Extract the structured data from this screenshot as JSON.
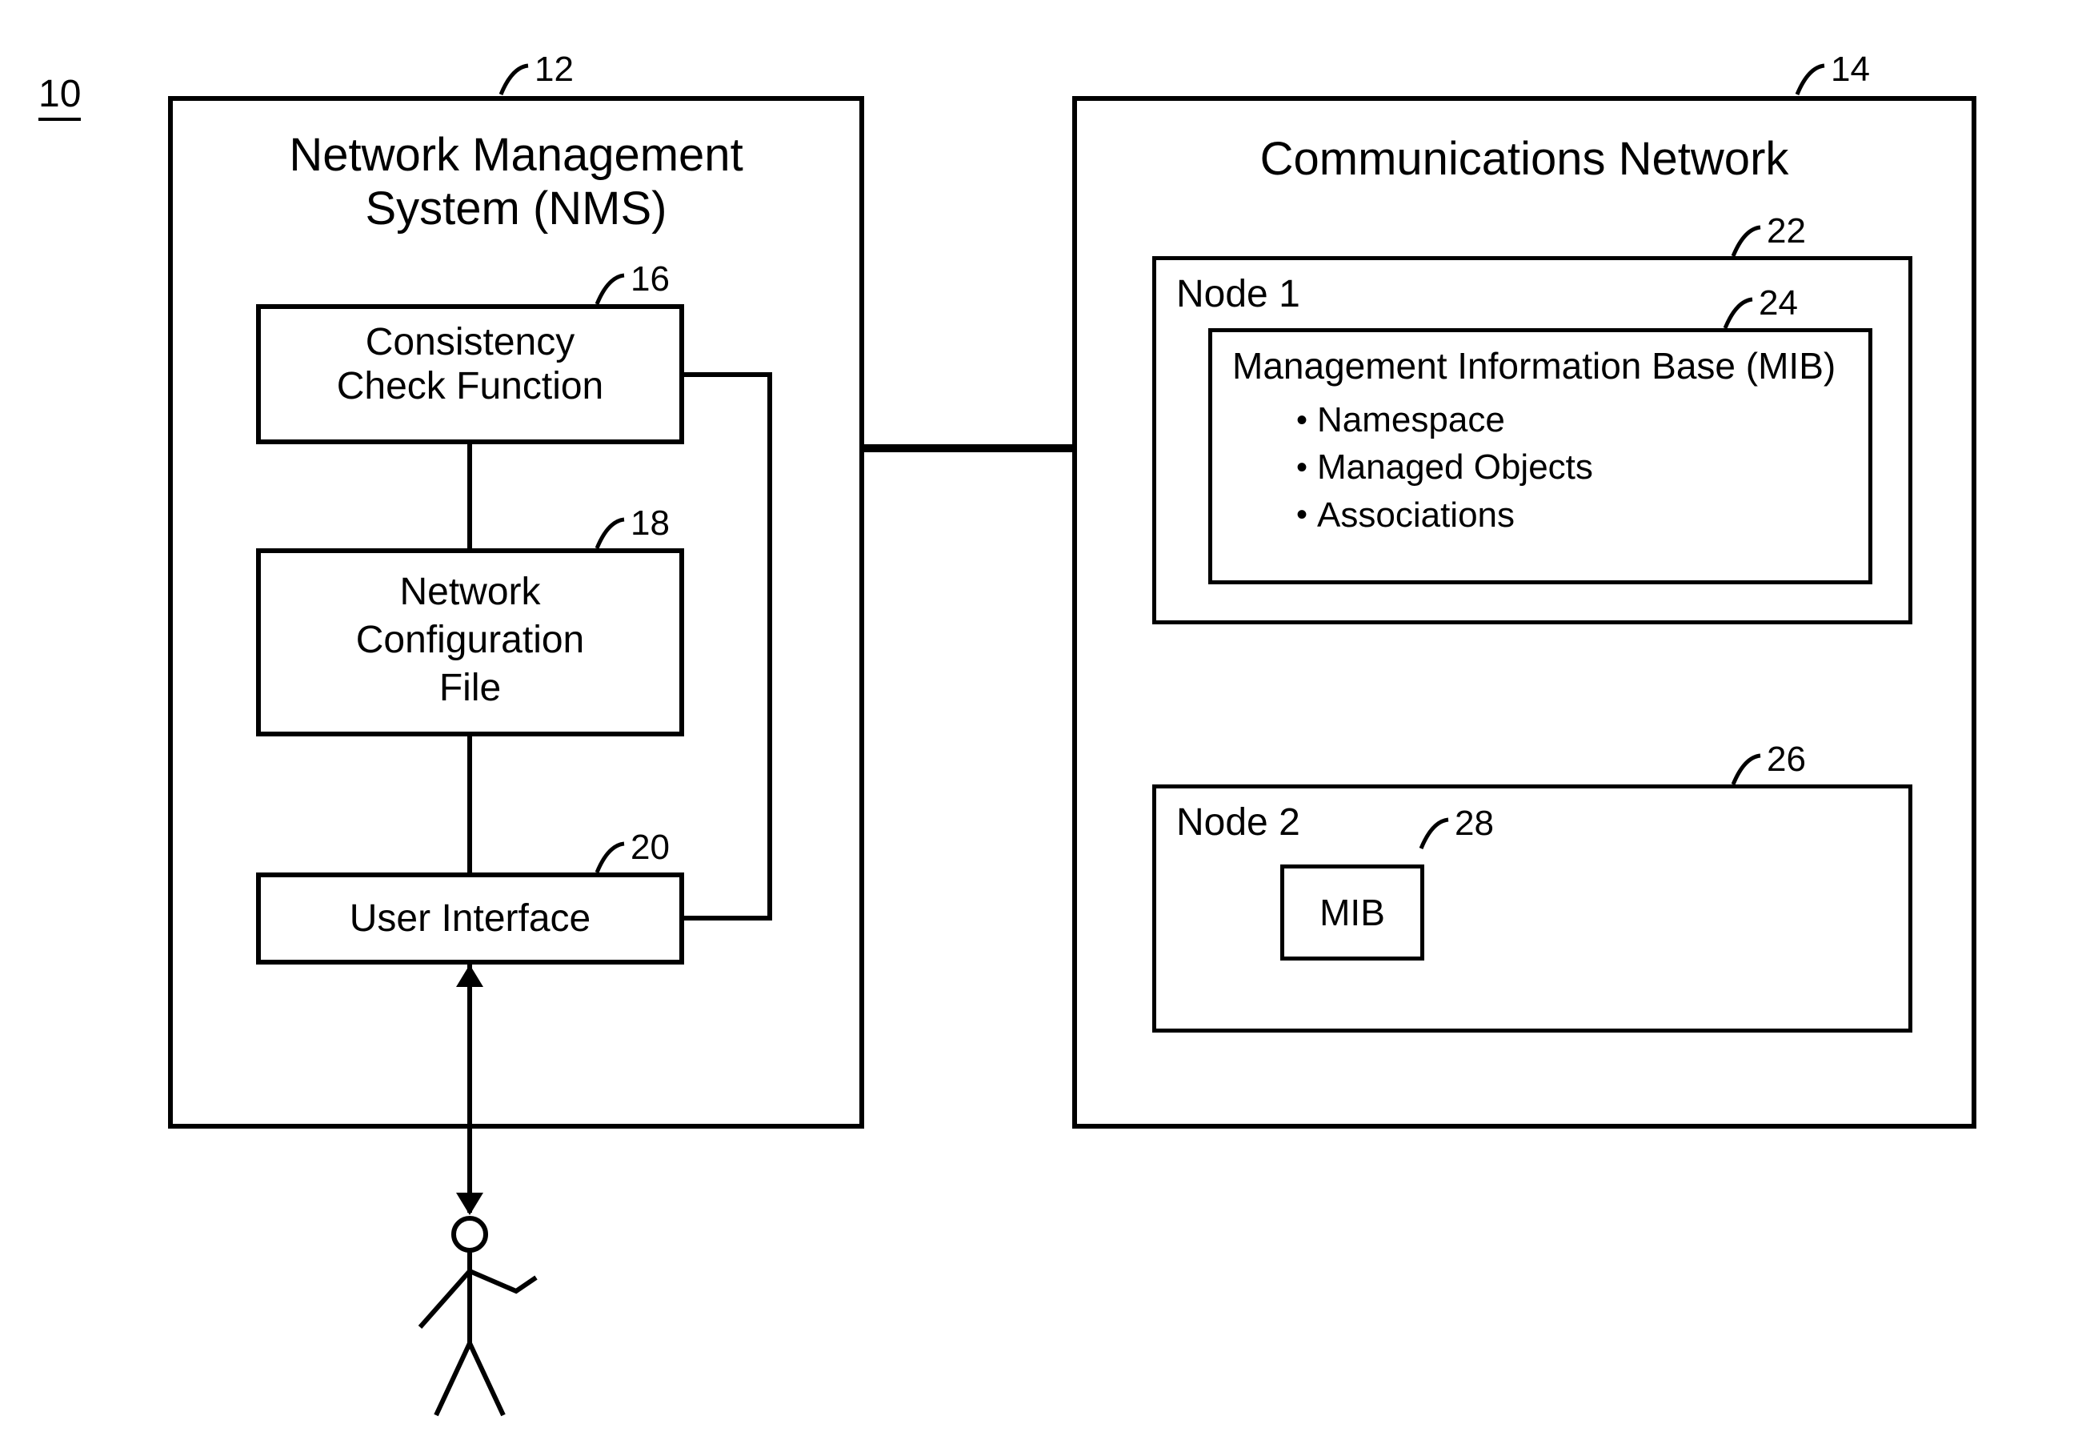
{
  "figure_number": "10",
  "nms": {
    "title_line1": "Network Management",
    "title_line2": "System (NMS)",
    "ref": "12",
    "consistency": {
      "line1": "Consistency",
      "line2": "Check Function",
      "ref": "16"
    },
    "config": {
      "line1": "Network",
      "line2": "Configuration",
      "line3": "File",
      "ref": "18"
    },
    "ui": {
      "label": "User Interface",
      "ref": "20"
    }
  },
  "network": {
    "title": "Communications Network",
    "ref": "14",
    "node1": {
      "label": "Node 1",
      "ref": "22",
      "mib": {
        "title": "Management Information Base (MIB)",
        "bullet1": "Namespace",
        "bullet2": "Managed Objects",
        "bullet3": "Associations",
        "ref": "24"
      }
    },
    "node2": {
      "label": "Node 2",
      "ref": "26",
      "mib": {
        "label": "MIB",
        "ref": "28"
      }
    }
  }
}
